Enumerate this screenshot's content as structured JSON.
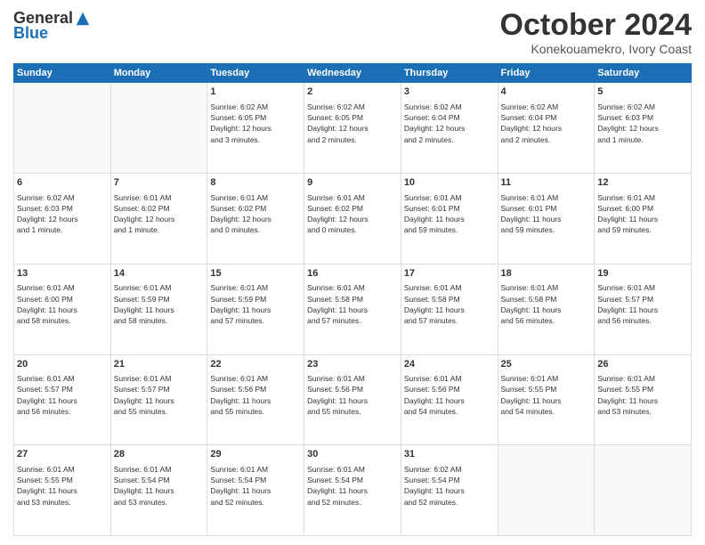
{
  "header": {
    "logo_general": "General",
    "logo_blue": "Blue",
    "month_title": "October 2024",
    "location": "Konekouamekro, Ivory Coast"
  },
  "weekdays": [
    "Sunday",
    "Monday",
    "Tuesday",
    "Wednesday",
    "Thursday",
    "Friday",
    "Saturday"
  ],
  "weeks": [
    [
      {
        "day": "",
        "info": ""
      },
      {
        "day": "",
        "info": ""
      },
      {
        "day": "1",
        "info": "Sunrise: 6:02 AM\nSunset: 6:05 PM\nDaylight: 12 hours\nand 3 minutes."
      },
      {
        "day": "2",
        "info": "Sunrise: 6:02 AM\nSunset: 6:05 PM\nDaylight: 12 hours\nand 2 minutes."
      },
      {
        "day": "3",
        "info": "Sunrise: 6:02 AM\nSunset: 6:04 PM\nDaylight: 12 hours\nand 2 minutes."
      },
      {
        "day": "4",
        "info": "Sunrise: 6:02 AM\nSunset: 6:04 PM\nDaylight: 12 hours\nand 2 minutes."
      },
      {
        "day": "5",
        "info": "Sunrise: 6:02 AM\nSunset: 6:03 PM\nDaylight: 12 hours\nand 1 minute."
      }
    ],
    [
      {
        "day": "6",
        "info": "Sunrise: 6:02 AM\nSunset: 6:03 PM\nDaylight: 12 hours\nand 1 minute."
      },
      {
        "day": "7",
        "info": "Sunrise: 6:01 AM\nSunset: 6:02 PM\nDaylight: 12 hours\nand 1 minute."
      },
      {
        "day": "8",
        "info": "Sunrise: 6:01 AM\nSunset: 6:02 PM\nDaylight: 12 hours\nand 0 minutes."
      },
      {
        "day": "9",
        "info": "Sunrise: 6:01 AM\nSunset: 6:02 PM\nDaylight: 12 hours\nand 0 minutes."
      },
      {
        "day": "10",
        "info": "Sunrise: 6:01 AM\nSunset: 6:01 PM\nDaylight: 11 hours\nand 59 minutes."
      },
      {
        "day": "11",
        "info": "Sunrise: 6:01 AM\nSunset: 6:01 PM\nDaylight: 11 hours\nand 59 minutes."
      },
      {
        "day": "12",
        "info": "Sunrise: 6:01 AM\nSunset: 6:00 PM\nDaylight: 11 hours\nand 59 minutes."
      }
    ],
    [
      {
        "day": "13",
        "info": "Sunrise: 6:01 AM\nSunset: 6:00 PM\nDaylight: 11 hours\nand 58 minutes."
      },
      {
        "day": "14",
        "info": "Sunrise: 6:01 AM\nSunset: 5:59 PM\nDaylight: 11 hours\nand 58 minutes."
      },
      {
        "day": "15",
        "info": "Sunrise: 6:01 AM\nSunset: 5:59 PM\nDaylight: 11 hours\nand 57 minutes."
      },
      {
        "day": "16",
        "info": "Sunrise: 6:01 AM\nSunset: 5:58 PM\nDaylight: 11 hours\nand 57 minutes."
      },
      {
        "day": "17",
        "info": "Sunrise: 6:01 AM\nSunset: 5:58 PM\nDaylight: 11 hours\nand 57 minutes."
      },
      {
        "day": "18",
        "info": "Sunrise: 6:01 AM\nSunset: 5:58 PM\nDaylight: 11 hours\nand 56 minutes."
      },
      {
        "day": "19",
        "info": "Sunrise: 6:01 AM\nSunset: 5:57 PM\nDaylight: 11 hours\nand 56 minutes."
      }
    ],
    [
      {
        "day": "20",
        "info": "Sunrise: 6:01 AM\nSunset: 5:57 PM\nDaylight: 11 hours\nand 56 minutes."
      },
      {
        "day": "21",
        "info": "Sunrise: 6:01 AM\nSunset: 5:57 PM\nDaylight: 11 hours\nand 55 minutes."
      },
      {
        "day": "22",
        "info": "Sunrise: 6:01 AM\nSunset: 5:56 PM\nDaylight: 11 hours\nand 55 minutes."
      },
      {
        "day": "23",
        "info": "Sunrise: 6:01 AM\nSunset: 5:56 PM\nDaylight: 11 hours\nand 55 minutes."
      },
      {
        "day": "24",
        "info": "Sunrise: 6:01 AM\nSunset: 5:56 PM\nDaylight: 11 hours\nand 54 minutes."
      },
      {
        "day": "25",
        "info": "Sunrise: 6:01 AM\nSunset: 5:55 PM\nDaylight: 11 hours\nand 54 minutes."
      },
      {
        "day": "26",
        "info": "Sunrise: 6:01 AM\nSunset: 5:55 PM\nDaylight: 11 hours\nand 53 minutes."
      }
    ],
    [
      {
        "day": "27",
        "info": "Sunrise: 6:01 AM\nSunset: 5:55 PM\nDaylight: 11 hours\nand 53 minutes."
      },
      {
        "day": "28",
        "info": "Sunrise: 6:01 AM\nSunset: 5:54 PM\nDaylight: 11 hours\nand 53 minutes."
      },
      {
        "day": "29",
        "info": "Sunrise: 6:01 AM\nSunset: 5:54 PM\nDaylight: 11 hours\nand 52 minutes."
      },
      {
        "day": "30",
        "info": "Sunrise: 6:01 AM\nSunset: 5:54 PM\nDaylight: 11 hours\nand 52 minutes."
      },
      {
        "day": "31",
        "info": "Sunrise: 6:02 AM\nSunset: 5:54 PM\nDaylight: 11 hours\nand 52 minutes."
      },
      {
        "day": "",
        "info": ""
      },
      {
        "day": "",
        "info": ""
      }
    ]
  ]
}
